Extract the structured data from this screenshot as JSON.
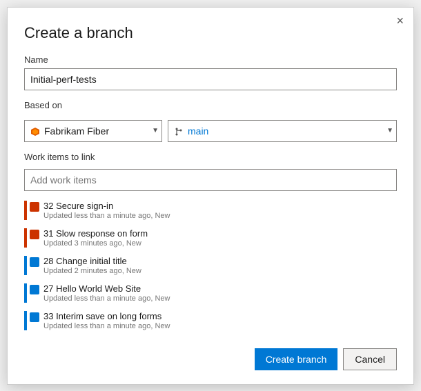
{
  "dialog": {
    "title": "Create a branch",
    "close_label": "×",
    "name_label": "Name",
    "name_value": "Initial-perf-tests",
    "based_on_label": "Based on",
    "repo_name": "Fabrikam Fiber",
    "branch_name": "main",
    "work_items_label": "Work items to link",
    "work_items_placeholder": "Add work items",
    "work_items": [
      {
        "id": "32",
        "title": "Secure sign-in",
        "meta": "Updated less than a minute ago, New",
        "type": "bug",
        "accent": "red"
      },
      {
        "id": "31",
        "title": "Slow response on form",
        "meta": "Updated 3 minutes ago, New",
        "type": "bug",
        "accent": "red"
      },
      {
        "id": "28",
        "title": "Change initial title",
        "meta": "Updated 2 minutes ago, New",
        "type": "story",
        "accent": "blue"
      },
      {
        "id": "27",
        "title": "Hello World Web Site",
        "meta": "Updated less than a minute ago, New",
        "type": "story",
        "accent": "blue"
      },
      {
        "id": "33",
        "title": "Interim save on long forms",
        "meta": "Updated less than a minute ago, New",
        "type": "story",
        "accent": "blue"
      }
    ],
    "create_button_label": "Create branch",
    "cancel_button_label": "Cancel"
  }
}
